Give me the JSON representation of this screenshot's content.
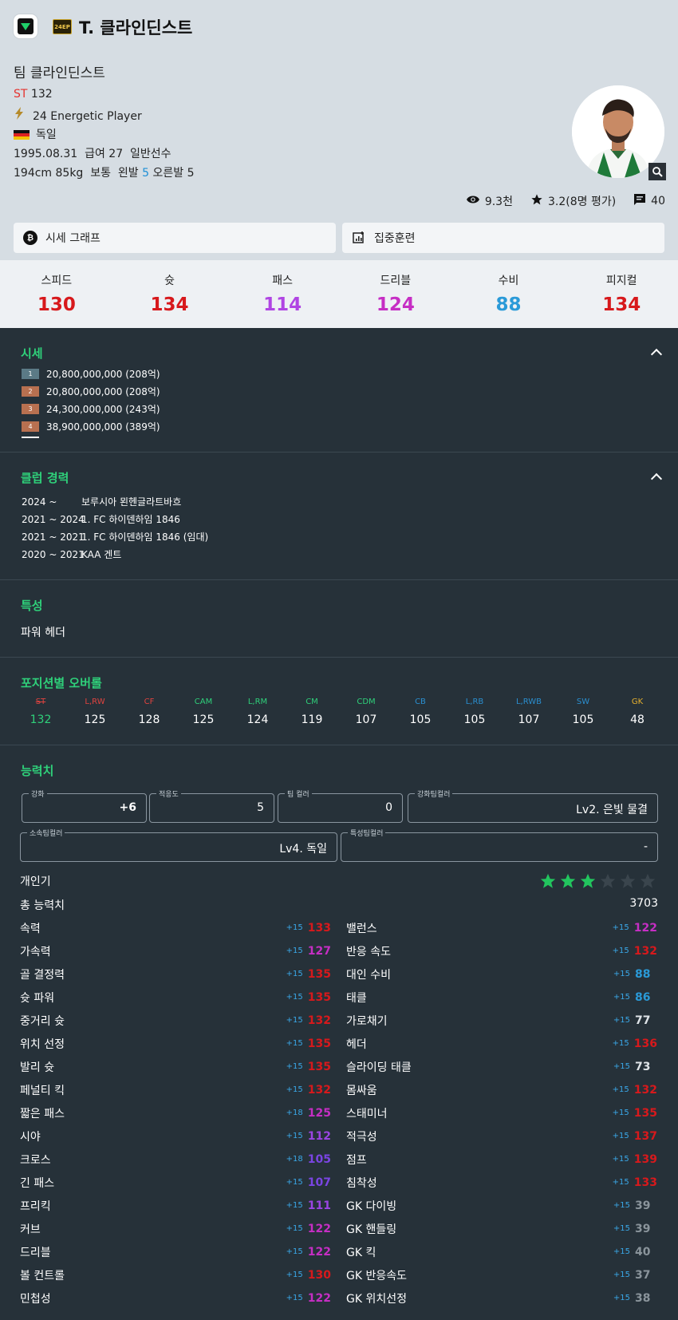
{
  "header": {
    "badge": "24EP",
    "title": "T. 클라인딘스트"
  },
  "player": {
    "team_name": "팀 클라인딘스트",
    "position": "ST",
    "position_ovr": "132",
    "season": "24 Energetic Player",
    "nation": "독일",
    "birth": "1995.08.31",
    "salary": "급여 27",
    "type": "일반선수",
    "height_weight": "194cm 85kg",
    "body": "보통",
    "left_foot_label": "왼발",
    "left_foot": "5",
    "right_foot_label": "오른발",
    "right_foot": "5"
  },
  "social": {
    "views": "9.3천",
    "rating": "3.2(8명 평가)",
    "comments": "40"
  },
  "buttons": {
    "price_graph": "시세 그래프",
    "training": "집중훈련"
  },
  "attributes": [
    {
      "label": "스피드",
      "value": "130",
      "color": "#d7191c"
    },
    {
      "label": "슛",
      "value": "134",
      "color": "#d7191c"
    },
    {
      "label": "패스",
      "value": "114",
      "color": "#b045e3"
    },
    {
      "label": "드리블",
      "value": "124",
      "color": "#c62ec4"
    },
    {
      "label": "수비",
      "value": "88",
      "color": "#2a9ad8"
    },
    {
      "label": "피지컬",
      "value": "134",
      "color": "#d7191c"
    }
  ],
  "price": {
    "title": "시세",
    "rows": [
      {
        "badge": "1",
        "text": "20,800,000,000 (208억)",
        "color": "#5b7a86"
      },
      {
        "badge": "2",
        "text": "20,800,000,000 (208억)",
        "color": "#b87050"
      },
      {
        "badge": "3",
        "text": "24,300,000,000 (243억)",
        "color": "#b87050"
      },
      {
        "badge": "4",
        "text": "38,900,000,000 (389억)",
        "color": "#b87050"
      }
    ]
  },
  "career": {
    "title": "클럽 경력",
    "rows": [
      {
        "years": "2024 ~",
        "club": "보루시아 묀헨글라트바흐"
      },
      {
        "years": "2021 ~ 2024",
        "club": "1. FC 하이덴하임 1846"
      },
      {
        "years": "2021 ~ 2021",
        "club": "1. FC 하이덴하임 1846 (임대)"
      },
      {
        "years": "2020 ~ 2021",
        "club": "KAA 겐트"
      }
    ]
  },
  "traits": {
    "title": "특성",
    "items": [
      "파워 헤더"
    ]
  },
  "position_ovr": {
    "title": "포지션별 오버롤",
    "cells": [
      {
        "pos": "ST",
        "val": "132",
        "color": "#e0433f",
        "strike": true,
        "hl": true
      },
      {
        "pos": "L,RW",
        "val": "125",
        "color": "#e0433f"
      },
      {
        "pos": "CF",
        "val": "128",
        "color": "#e0433f"
      },
      {
        "pos": "CAM",
        "val": "125",
        "color": "#2fd07a"
      },
      {
        "pos": "L,RM",
        "val": "124",
        "color": "#2fd07a"
      },
      {
        "pos": "CM",
        "val": "119",
        "color": "#2fd07a"
      },
      {
        "pos": "CDM",
        "val": "107",
        "color": "#2fd07a"
      },
      {
        "pos": "CB",
        "val": "105",
        "color": "#2a8fd0"
      },
      {
        "pos": "L,RB",
        "val": "105",
        "color": "#2a8fd0"
      },
      {
        "pos": "L,RWB",
        "val": "107",
        "color": "#2a8fd0"
      },
      {
        "pos": "SW",
        "val": "105",
        "color": "#2a8fd0"
      },
      {
        "pos": "GK",
        "val": "48",
        "color": "#e6b02e"
      }
    ]
  },
  "abilities": {
    "title": "능력치",
    "fields": {
      "upgrade_label": "강화",
      "upgrade": "+6",
      "adapt_label": "적응도",
      "adapt": "5",
      "teamcolor_label": "팀 컬러",
      "teamcolor": "0",
      "upgrade_team_label": "강화팀컬러",
      "upgrade_team": "Lv2. 은빛 물결",
      "club_team_label": "소속팀컬러",
      "club_team": "Lv4. 독일",
      "trait_team_label": "특성팀컬러",
      "trait_team": "-"
    },
    "popularity_label": "개인기",
    "popularity_stars": 3,
    "popularity_max": 6,
    "total_label": "총 능력치",
    "total": "3703",
    "left": [
      {
        "name": "속력",
        "bonus": "+15",
        "value": "133",
        "color": "#d7191c"
      },
      {
        "name": "가속력",
        "bonus": "+15",
        "value": "127",
        "color": "#c62ec4"
      },
      {
        "name": "골 결정력",
        "bonus": "+15",
        "value": "135",
        "color": "#d7191c"
      },
      {
        "name": "슛 파워",
        "bonus": "+15",
        "value": "135",
        "color": "#d7191c"
      },
      {
        "name": "중거리 슛",
        "bonus": "+15",
        "value": "132",
        "color": "#d7191c"
      },
      {
        "name": "위치 선정",
        "bonus": "+15",
        "value": "135",
        "color": "#d7191c"
      },
      {
        "name": "발리 슛",
        "bonus": "+15",
        "value": "135",
        "color": "#d7191c"
      },
      {
        "name": "페널티 킥",
        "bonus": "+15",
        "value": "132",
        "color": "#d7191c"
      },
      {
        "name": "짧은 패스",
        "bonus": "+18",
        "value": "125",
        "color": "#c62ec4"
      },
      {
        "name": "시야",
        "bonus": "+15",
        "value": "112",
        "color": "#9b45e3"
      },
      {
        "name": "크로스",
        "bonus": "+18",
        "value": "105",
        "color": "#7a45e3"
      },
      {
        "name": "긴 패스",
        "bonus": "+15",
        "value": "107",
        "color": "#7a45e3"
      },
      {
        "name": "프리킥",
        "bonus": "+15",
        "value": "111",
        "color": "#9b45e3"
      },
      {
        "name": "커브",
        "bonus": "+15",
        "value": "122",
        "color": "#c62ec4"
      },
      {
        "name": "드리블",
        "bonus": "+15",
        "value": "122",
        "color": "#c62ec4"
      },
      {
        "name": "볼 컨트롤",
        "bonus": "+15",
        "value": "130",
        "color": "#d7191c"
      },
      {
        "name": "민첩성",
        "bonus": "+15",
        "value": "122",
        "color": "#c62ec4"
      }
    ],
    "right": [
      {
        "name": "밸런스",
        "bonus": "+15",
        "value": "122",
        "color": "#c62ec4"
      },
      {
        "name": "반응 속도",
        "bonus": "+15",
        "value": "132",
        "color": "#d7191c"
      },
      {
        "name": "대인 수비",
        "bonus": "+15",
        "value": "88",
        "color": "#2a9ad8"
      },
      {
        "name": "태클",
        "bonus": "+15",
        "value": "86",
        "color": "#2a9ad8"
      },
      {
        "name": "가로채기",
        "bonus": "+15",
        "value": "77",
        "color": "#dfe4e8"
      },
      {
        "name": "헤더",
        "bonus": "+15",
        "value": "136",
        "color": "#d7191c"
      },
      {
        "name": "슬라이딩 태클",
        "bonus": "+15",
        "value": "73",
        "color": "#dfe4e8"
      },
      {
        "name": "몸싸움",
        "bonus": "+15",
        "value": "132",
        "color": "#d7191c"
      },
      {
        "name": "스태미너",
        "bonus": "+15",
        "value": "135",
        "color": "#d7191c"
      },
      {
        "name": "적극성",
        "bonus": "+15",
        "value": "137",
        "color": "#d7191c"
      },
      {
        "name": "점프",
        "bonus": "+15",
        "value": "139",
        "color": "#d7191c"
      },
      {
        "name": "침착성",
        "bonus": "+15",
        "value": "133",
        "color": "#d7191c"
      },
      {
        "name": "GK 다이빙",
        "bonus": "+15",
        "value": "39",
        "color": "#8a949b"
      },
      {
        "name": "GK 핸들링",
        "bonus": "+15",
        "value": "39",
        "color": "#8a949b"
      },
      {
        "name": "GK 킥",
        "bonus": "+15",
        "value": "40",
        "color": "#8a949b"
      },
      {
        "name": "GK 반응속도",
        "bonus": "+15",
        "value": "37",
        "color": "#8a949b"
      },
      {
        "name": "GK 위치선정",
        "bonus": "+15",
        "value": "38",
        "color": "#8a949b"
      }
    ]
  }
}
